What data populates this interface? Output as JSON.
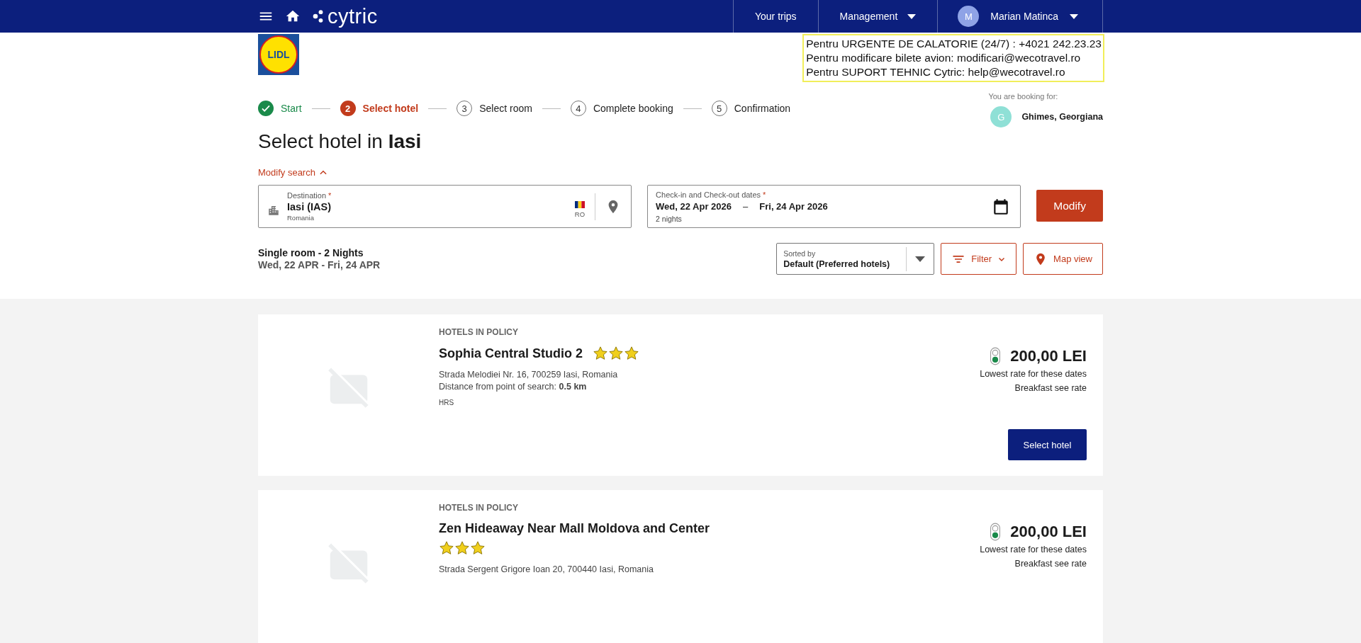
{
  "nav": {
    "brand": "cytric",
    "items": [
      {
        "label": "Your trips",
        "dropdown": false
      },
      {
        "label": "Management",
        "dropdown": true
      }
    ],
    "user": {
      "initial": "M",
      "name": "Marian Matinca"
    }
  },
  "notice": [
    "Pentru URGENTE DE CALATORIE (24/7) : +4021 242.23.23",
    "Pentru modificare bilete avion:  modificari@wecotravel.ro",
    "Pentru SUPORT TEHNIC Cytric:  help@wecotravel.ro"
  ],
  "client_logo": "LIDL",
  "steps": [
    {
      "label": "Start",
      "done": true,
      "selected": false
    },
    {
      "number": "2",
      "label": "Select hotel",
      "done": false,
      "selected": true
    },
    {
      "number": "3",
      "label": "Select room",
      "done": false,
      "selected": false
    },
    {
      "number": "4",
      "label": "Complete booking",
      "done": false,
      "selected": false
    },
    {
      "number": "5",
      "label": "Confirmation",
      "done": false,
      "selected": false
    }
  ],
  "booking_for": {
    "label": "You are booking for:",
    "initial": "G",
    "name": "Ghimes, Georgiana"
  },
  "title": "Select hotel in **Iasi**",
  "modify_search": {
    "label": "Modify search",
    "expanded": true
  },
  "destination": {
    "label": "Destination",
    "required": "*",
    "value": "Iasi (IAS)",
    "sub": "Romania",
    "country": "RO"
  },
  "dates": {
    "label": "Check-in and Check-out dates",
    "required": "*",
    "checkin": "Wed, 22 Apr 2026",
    "separator": "–",
    "checkout": "Fri, 24 Apr 2026",
    "sub": "2 nights"
  },
  "modify_button": "Modify",
  "summary": {
    "room": "Single room - 2 Nights",
    "dates": "Wed, 22 APR - Fri, 24 APR"
  },
  "sort": {
    "label": "Sorted by",
    "value": "Default (Preferred hotels)"
  },
  "filter_button": "Filter",
  "map_button": "Map view",
  "hotels": [
    {
      "category": "HOTELS IN POLICY",
      "name": "Sophia Central Studio 2",
      "stars": 3,
      "address": "Strada Melodiei Nr. 16, 700259 Iasi, Romania",
      "distance_label": "Distance from point of search:",
      "distance": "0.5 km",
      "source": "HRS",
      "price": "200,00 LEI",
      "rate_note": "Lowest rate for these dates",
      "breakfast": "Breakfast see rate",
      "button": "Select hotel"
    },
    {
      "category": "HOTELS IN POLICY",
      "name": "Zen Hideaway Near Mall Moldova and Center",
      "stars": 3,
      "address": "Strada Sergent Grigore Ioan 20, 700440 Iasi, Romania",
      "price": "200,00 LEI",
      "rate_note": "Lowest rate for these dates",
      "breakfast": "Breakfast see rate"
    }
  ]
}
